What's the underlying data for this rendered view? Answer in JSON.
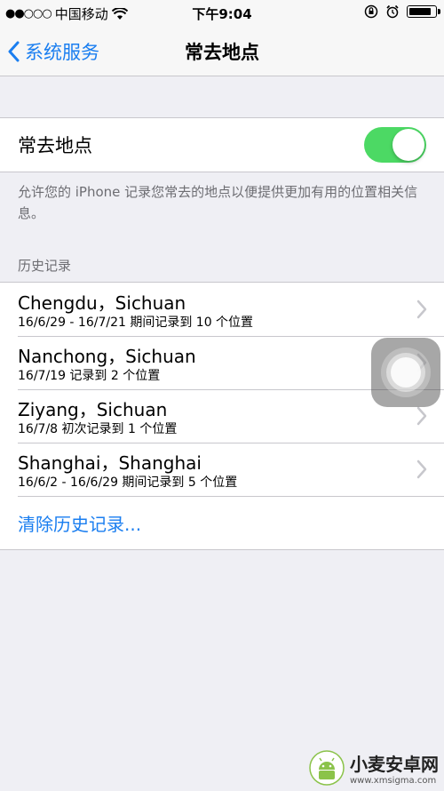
{
  "status_bar": {
    "signal_dots": "●●○○○",
    "carrier": "中国移动",
    "time": "下午9:04"
  },
  "nav": {
    "back_label": "系统服务",
    "title": "常去地点"
  },
  "toggle": {
    "label": "常去地点",
    "on": true,
    "on_color": "#4cd964"
  },
  "footnote": "允许您的 iPhone 记录您常去的地点以便提供更加有用的位置相关信息。",
  "history": {
    "header": "历史记录",
    "items": [
      {
        "place": "Chengdu，Sichuan",
        "detail": "16/6/29 - 16/7/21 期间记录到 10 个位置"
      },
      {
        "place": "Nanchong，Sichuan",
        "detail": "16/7/19 记录到 2 个位置"
      },
      {
        "place": "Ziyang，Sichuan",
        "detail": "16/7/8 初次记录到 1 个位置"
      },
      {
        "place": "Shanghai，Shanghai",
        "detail": "16/6/2 - 16/6/29 期间记录到 5 个位置"
      }
    ],
    "clear_label": "清除历史记录..."
  },
  "watermark": {
    "name": "小麦安卓网",
    "url": "www.xmsigma.com"
  },
  "colors": {
    "accent": "#1a7ef0",
    "background": "#efeff4"
  }
}
